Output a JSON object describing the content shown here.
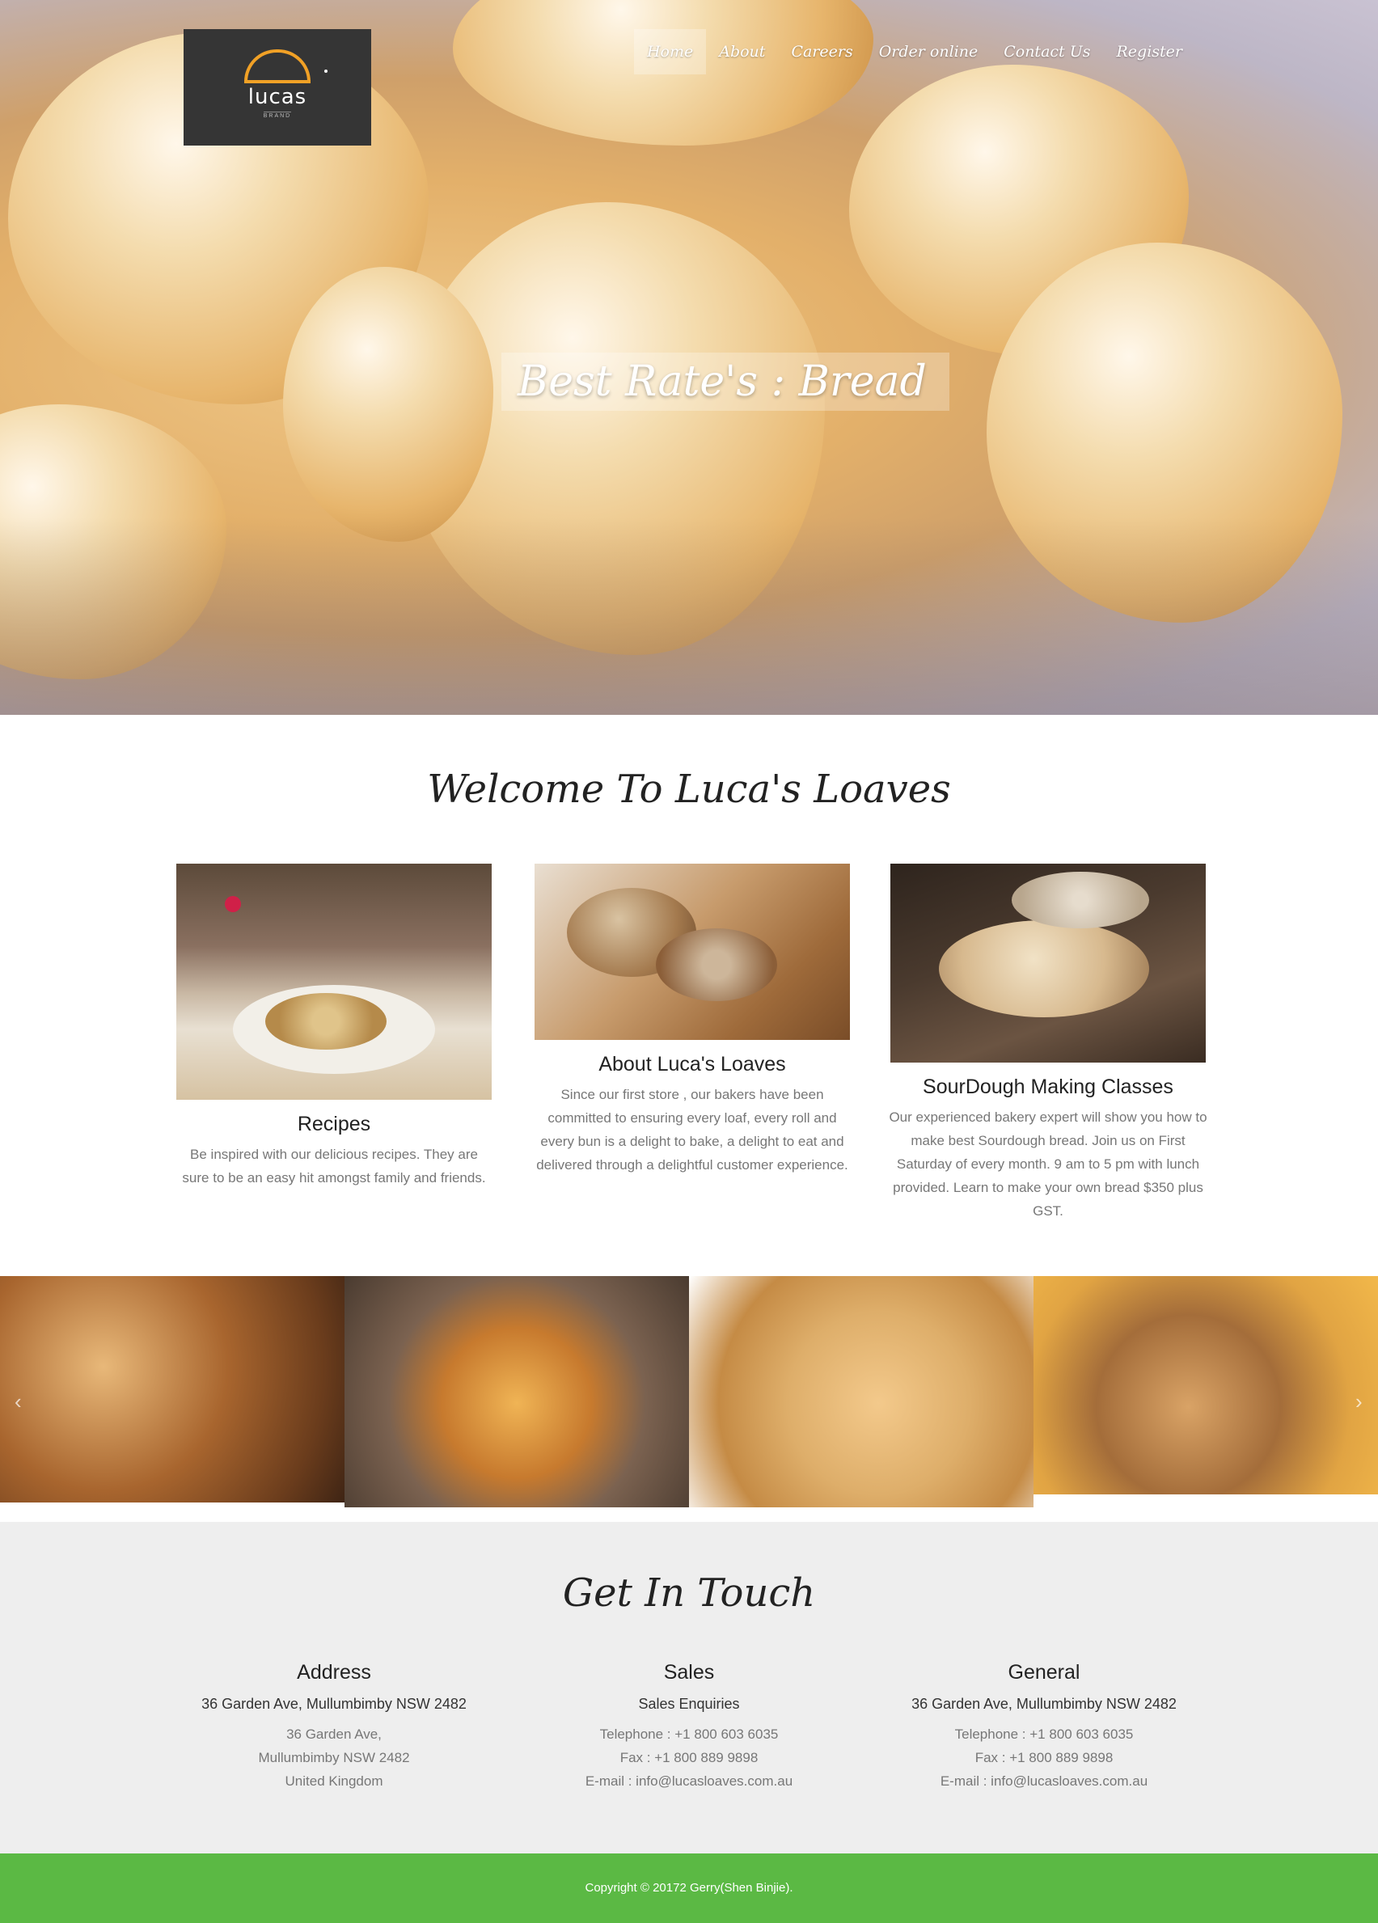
{
  "brand": {
    "logo_word": "lucas",
    "logo_sub": "BRAND"
  },
  "nav": {
    "items": [
      {
        "label": "Home",
        "active": true
      },
      {
        "label": "About"
      },
      {
        "label": "Careers"
      },
      {
        "label": "Order online"
      },
      {
        "label": "Contact Us"
      },
      {
        "label": "Register"
      }
    ]
  },
  "hero": {
    "title": "Best Rate's : Bread"
  },
  "welcome": {
    "title": "Welcome To Luca's Loaves",
    "cards": [
      {
        "title": "Recipes",
        "text": "Be inspired with our delicious recipes. They are sure to be an easy hit amongst family and friends."
      },
      {
        "title": "About Luca's Loaves",
        "text": "Since our first store , our bakers have been committed to ensuring every loaf, every roll and every bun is a delight to bake, a delight to eat and delivered through a delightful customer experience."
      },
      {
        "title": "SourDough Making Classes",
        "text": "Our experienced bakery expert will show you how to make best Sourdough bread. Join us on First Saturday of every month. 9 am to 5 pm with lunch provided. Learn to make your own bread $350 plus GST."
      }
    ]
  },
  "gallery": {
    "prev_arrow": "‹",
    "next_arrow": "›"
  },
  "contact": {
    "title": "Get In Touch",
    "columns": [
      {
        "heading": "Address",
        "lead": "36 Garden Ave, Mullumbimby NSW 2482",
        "lines": [
          "36 Garden Ave,",
          "Mullumbimby NSW 2482",
          "United Kingdom"
        ]
      },
      {
        "heading": "Sales",
        "lead": "Sales Enquiries",
        "lines": [
          "Telephone : +1 800 603 6035",
          "Fax : +1 800 889 9898",
          "E-mail : info@lucasloaves.com.au"
        ]
      },
      {
        "heading": "General",
        "lead": "36 Garden Ave, Mullumbimby NSW 2482",
        "lines": [
          "Telephone : +1 800 603 6035",
          "Fax : +1 800 889 9898",
          "E-mail : info@lucasloaves.com.au"
        ]
      }
    ]
  },
  "footer": {
    "copyright": "Copyright © 20172 Gerry(Shen Binjie)."
  },
  "colors": {
    "accent": "#5bb944",
    "logo_orange": "#f1a126",
    "logo_bg": "#353535",
    "contact_bg": "#eeeeee"
  }
}
